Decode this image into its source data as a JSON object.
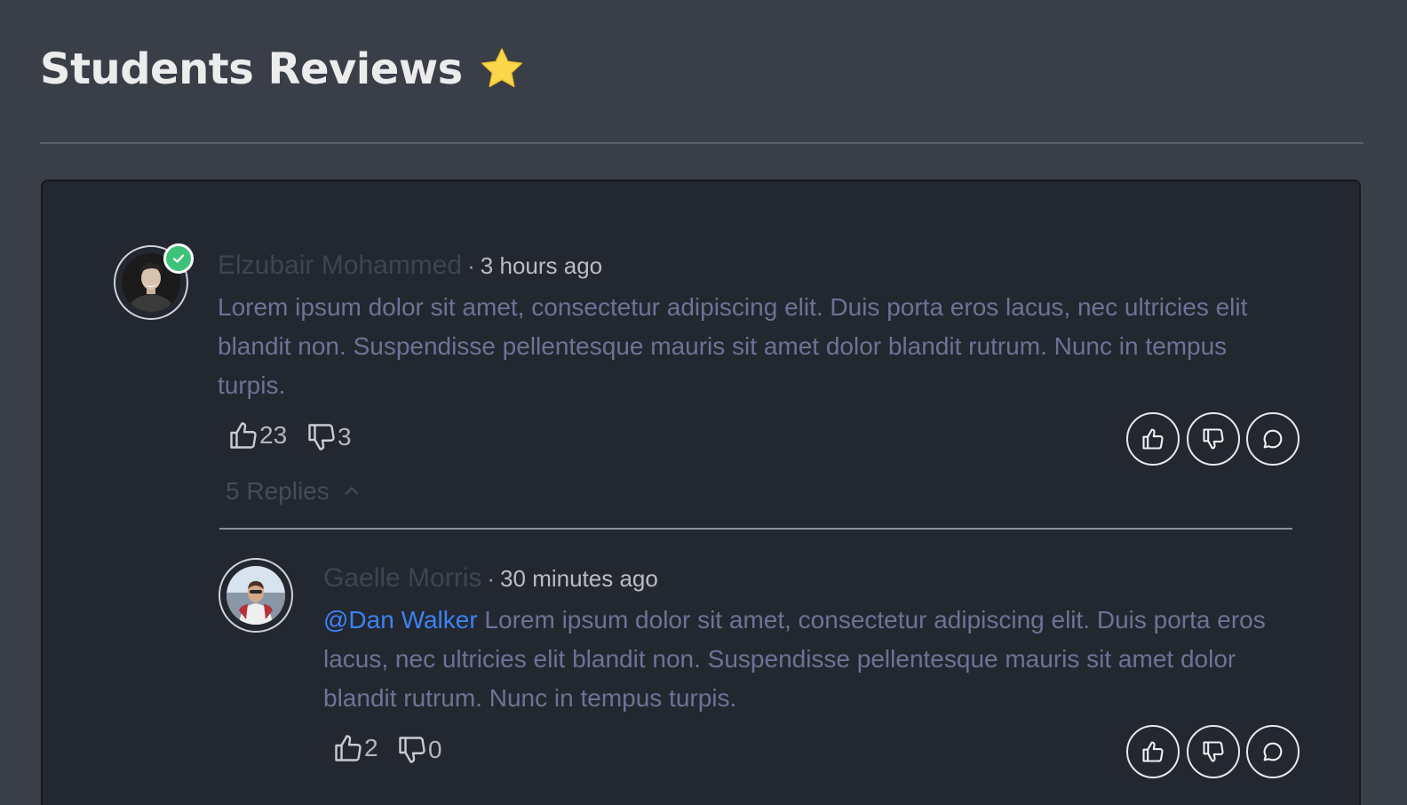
{
  "header": {
    "title": "Students Reviews",
    "star_icon": "star-icon",
    "star_color": "#f9d64a"
  },
  "reviews": [
    {
      "author": "Elzubair Mohammed",
      "separator": "·",
      "time": "3 hours ago",
      "verified": true,
      "text": "Lorem ipsum dolor sit amet, consectetur adipiscing elit. Duis porta eros lacus, nec ultricies elit blandit non. Suspendisse pellentesque mauris sit amet dolor blandit rutrum. Nunc in tempus turpis.",
      "likes": "23",
      "dislikes": "3",
      "replies_label": "5 Replies"
    }
  ],
  "replies": [
    {
      "author": "Gaelle Morris",
      "separator": "·",
      "time": "30 minutes ago",
      "mention": "@Dan Walker",
      "text": " Lorem ipsum dolor sit amet, consectetur adipiscing elit. Duis porta eros lacus, nec ultricies elit blandit non. Suspendisse pellentesque mauris sit amet dolor blandit rutrum. Nunc in tempus turpis.",
      "likes": "2",
      "dislikes": "0"
    }
  ],
  "colors": {
    "page_bg": "#3a3f47",
    "card_bg": "#232830",
    "body_text": "#6d7396",
    "mention": "#3b82f6",
    "verified_badge": "#3ec27a"
  }
}
